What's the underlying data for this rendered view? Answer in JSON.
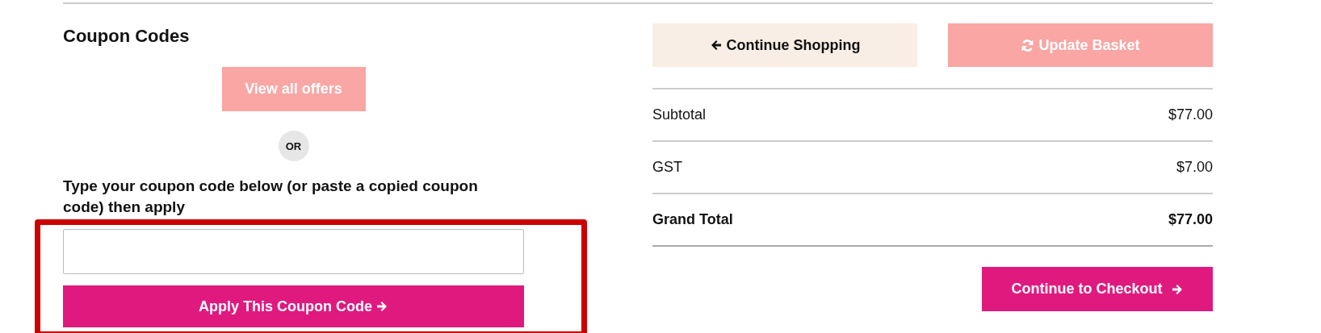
{
  "coupons": {
    "title": "Coupon Codes",
    "offers_button": "View all offers",
    "separator": "OR",
    "instruction": "Type your coupon code below (or paste a copied coupon code) then apply",
    "apply_button": "Apply This Coupon Code"
  },
  "actions": {
    "continue_button": "Continue Shopping",
    "update_button": "Update Basket"
  },
  "totals": [
    {
      "label": "Subtotal",
      "amount": "$77.00",
      "kind": "normal"
    },
    {
      "label": "GST",
      "amount": "$7.00",
      "kind": "normal"
    },
    {
      "label": "Grand Total",
      "amount": "$77.00",
      "kind": "total"
    }
  ],
  "checkout_button": "Continue to Checkout"
}
